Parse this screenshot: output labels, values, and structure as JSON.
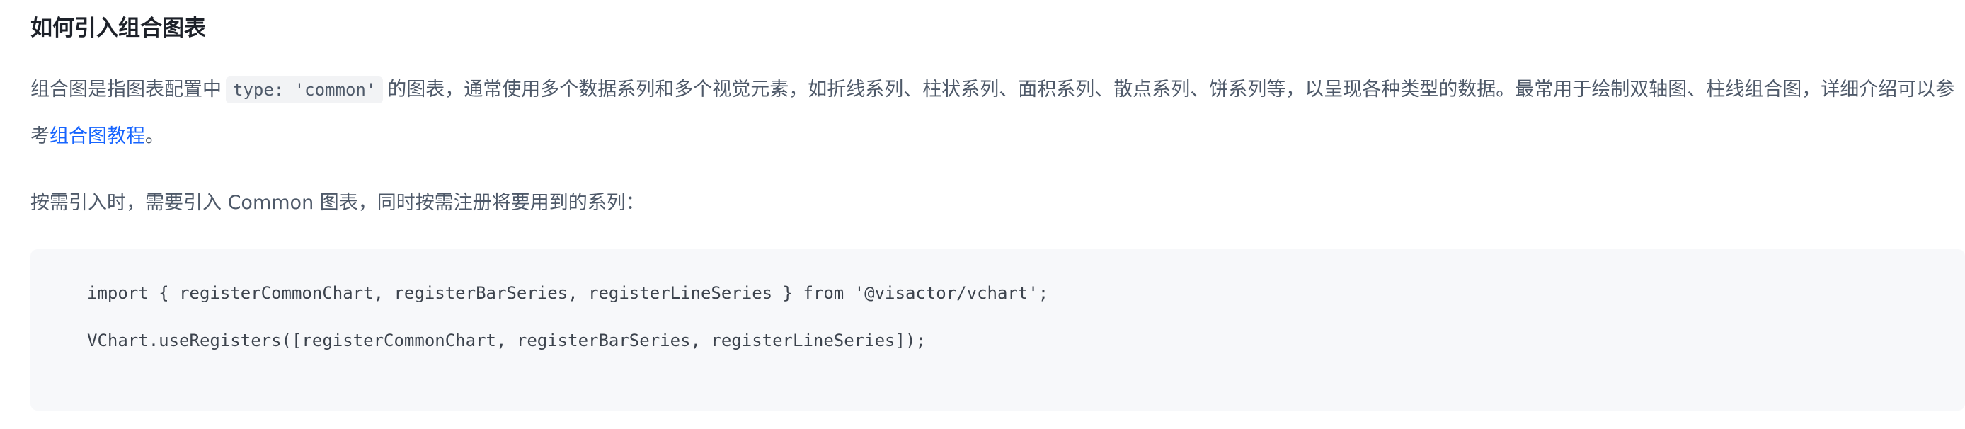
{
  "section": {
    "title": "如何引入组合图表",
    "intro": {
      "prefix": "组合图是指图表配置中",
      "code": "type: 'common'",
      "middle": "的图表，通常使用多个数据系列和多个视觉元素，如折线系列、柱状系列、面积系列、散点系列、饼系列等，以呈现各种类型的数据。最常用于绘制双轴图、柱线组合图，详细介绍可以参考",
      "link_text": "组合图教程",
      "suffix": "。"
    },
    "instruction": "按需引入时，需要引入 Common 图表，同时按需注册将要用到的系列："
  },
  "code_block": {
    "lines": [
      "import { registerCommonChart, registerBarSeries, registerLineSeries } from '@visactor/vchart';",
      "VChart.useRegisters([registerCommonChart, registerBarSeries, registerLineSeries]);"
    ]
  },
  "colors": {
    "heading": "#1d2129",
    "body_text": "#4e5969",
    "link": "#1664ff",
    "code_background": "#f7f8fa",
    "inline_code_background": "#f2f3f5"
  }
}
